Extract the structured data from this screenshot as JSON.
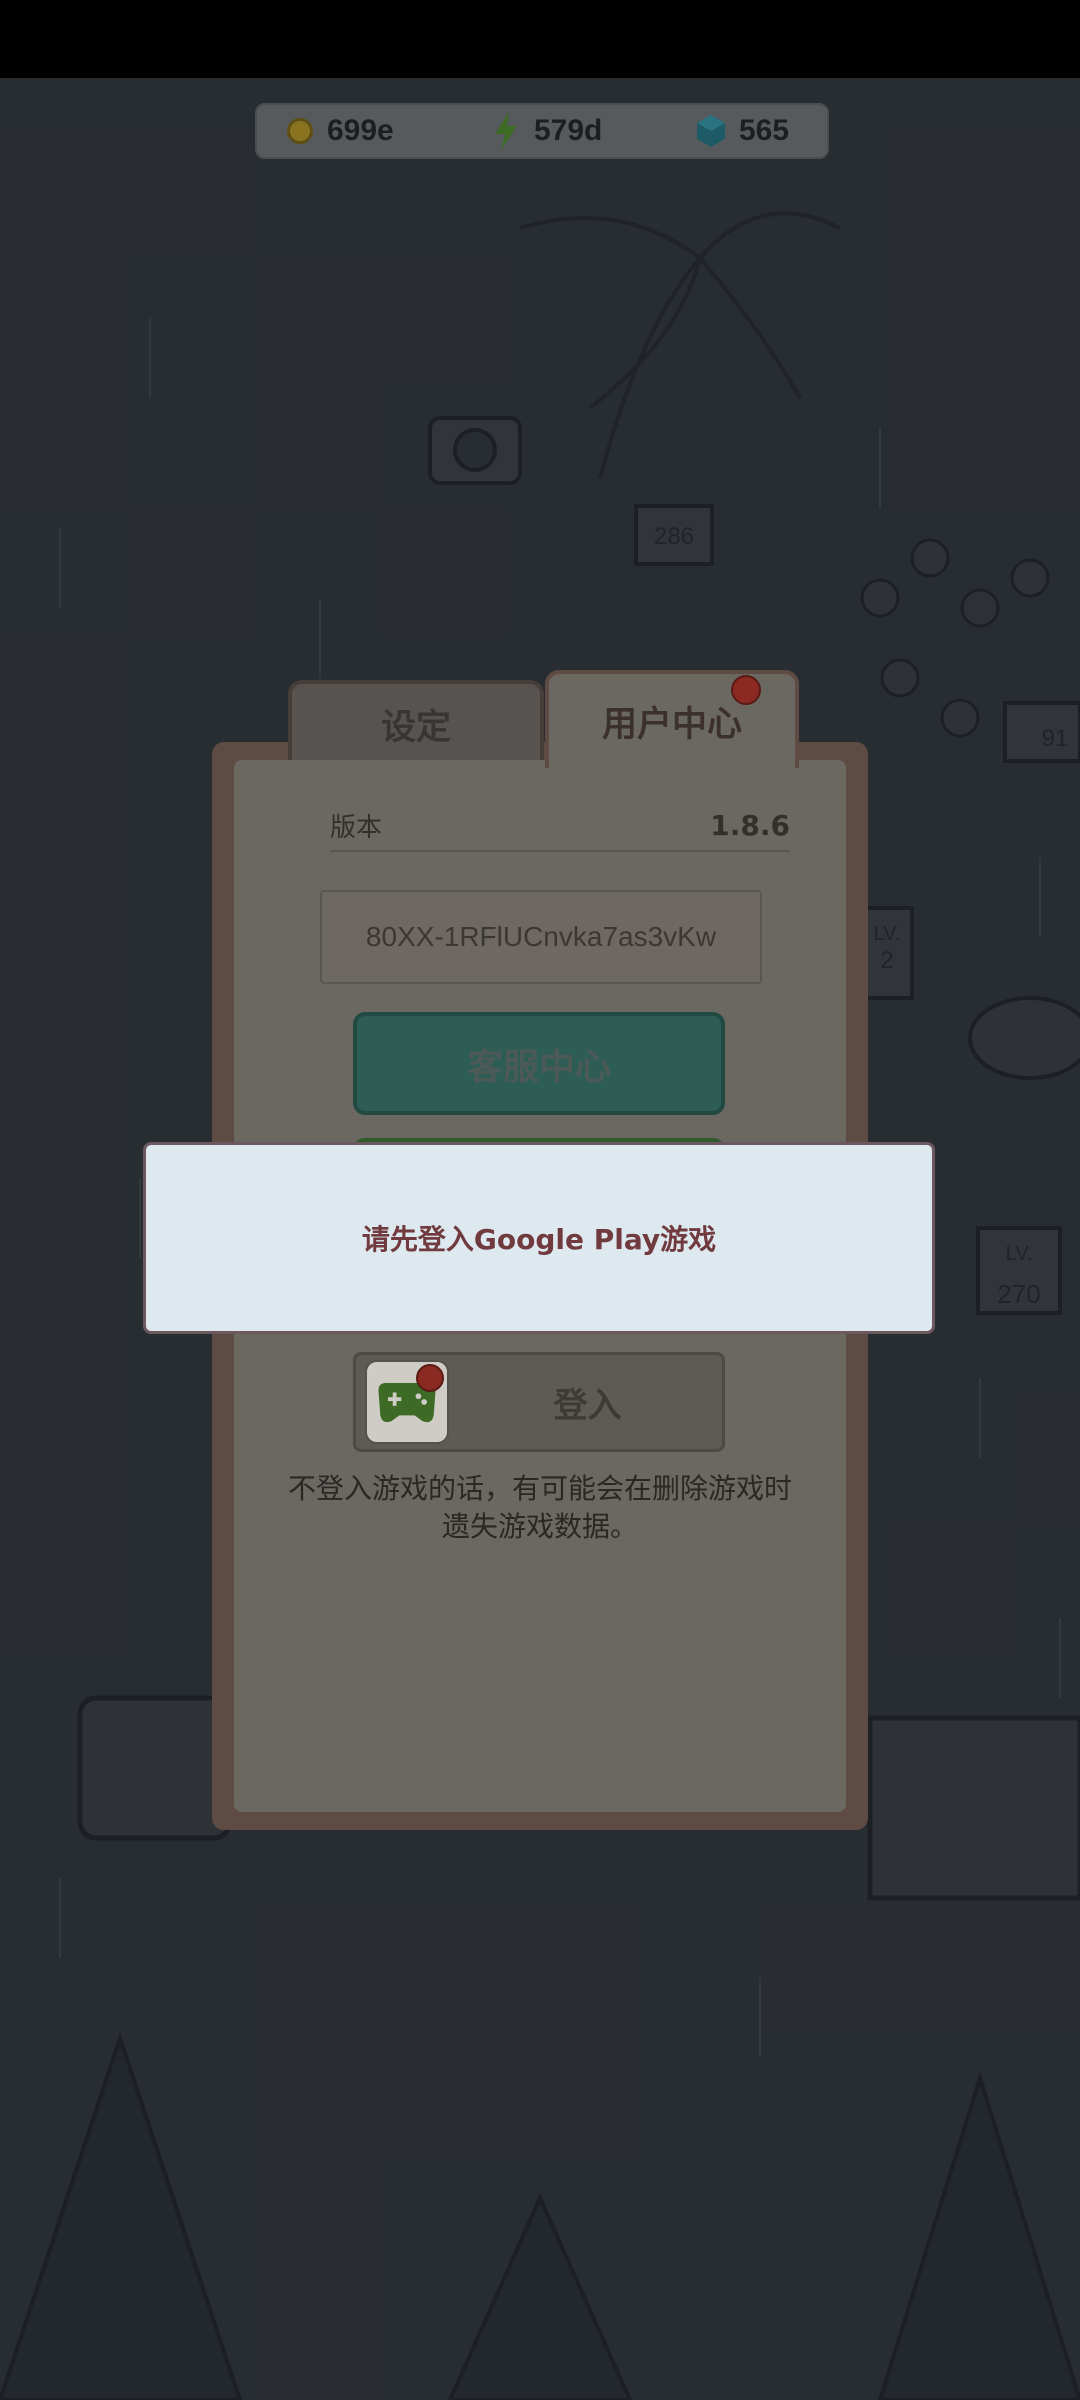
{
  "resources": {
    "coins": "699e",
    "energy": "579d",
    "gems": "565"
  },
  "scene_labels": {
    "sign_1": "286",
    "sign_2": "91",
    "lv_1_label": "LV.",
    "lv_1_value": "2",
    "lv_2_label": "LV.",
    "lv_2_value": "270"
  },
  "settings_panel": {
    "tab_settings": "设定",
    "tab_user_center": "用户中心",
    "version_label": "版本",
    "version_value": "1.8.6",
    "user_id": "80XX-1RFlUCnvka7as3vKw",
    "customer_service_label": "客服中心",
    "login_label": "登入",
    "warning_text": "不登入游戏的话，有可能会在删除游戏时遗失游戏数据。"
  },
  "toast": {
    "message": "请先登入Google Play游戏"
  },
  "colors": {
    "panel_border": "#5e4c44",
    "toast_bg": "#dde8ef",
    "toast_text": "#703a3f",
    "notification_dot": "#8b2a22"
  }
}
